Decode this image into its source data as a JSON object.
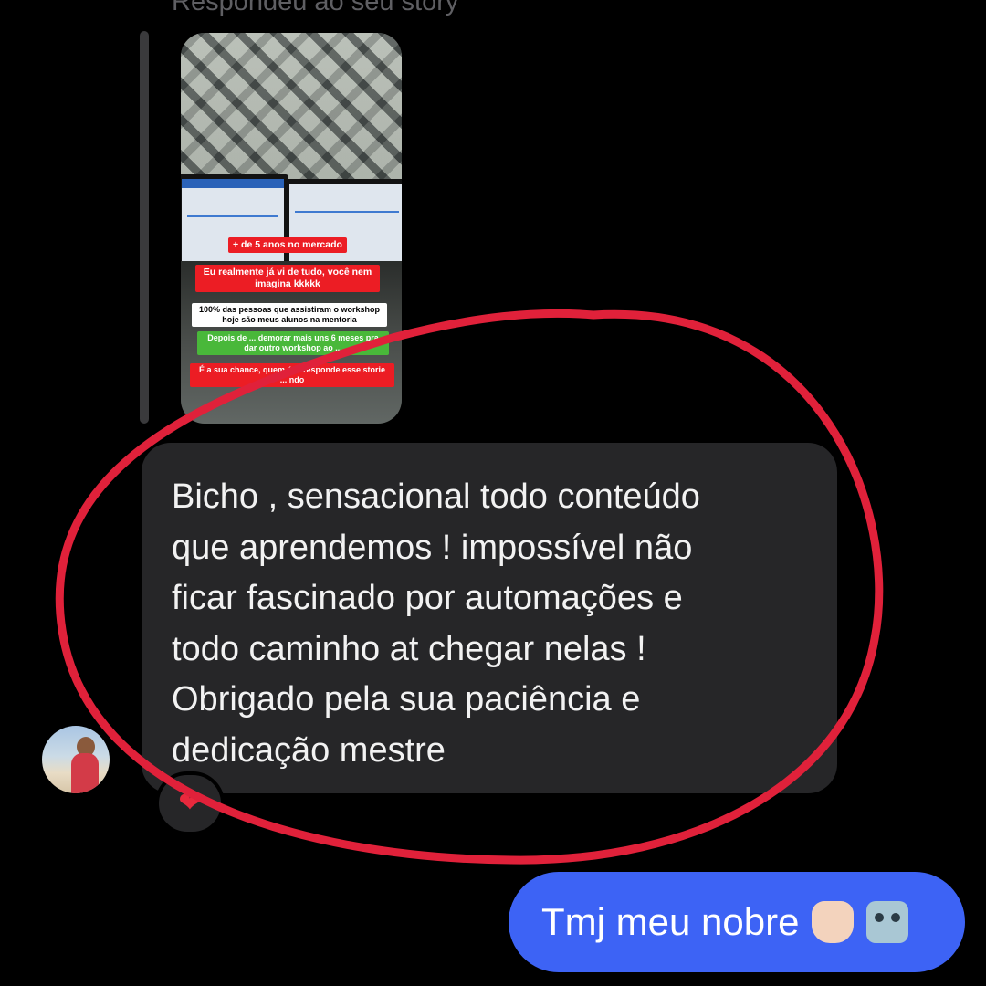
{
  "header": {
    "reply_label": "Respondeu ao seu story"
  },
  "story": {
    "tags": [
      "+ de 5 anos no mercado",
      "Eu realmente já vi de tudo, você nem imagina kkkkk",
      "100% das pessoas que assistiram o workshop hoje são meus alunos na mentoria",
      "Depois de ... demorar mais uns 6 meses pra dar outro workshop ao ...",
      "É a sua chance, quem é ... responde esse storie ... ndo"
    ]
  },
  "received_message": {
    "text": "Bicho , sensacional todo conteúdo\nque aprendemos ! impossível não\nficar fascinado por automações e\ntodo caminho at chegar nelas !\nObrigado pela sua paciência e\ndedicação mestre",
    "reaction": "❤"
  },
  "sent_message": {
    "text": "Tmj meu nobre",
    "emojis": [
      "fist-emoji",
      "robot-emoji"
    ]
  },
  "colors": {
    "background": "#000000",
    "received_bubble": "#262628",
    "sent_bubble": "#3d63f5",
    "annotation": "#e0213a"
  }
}
